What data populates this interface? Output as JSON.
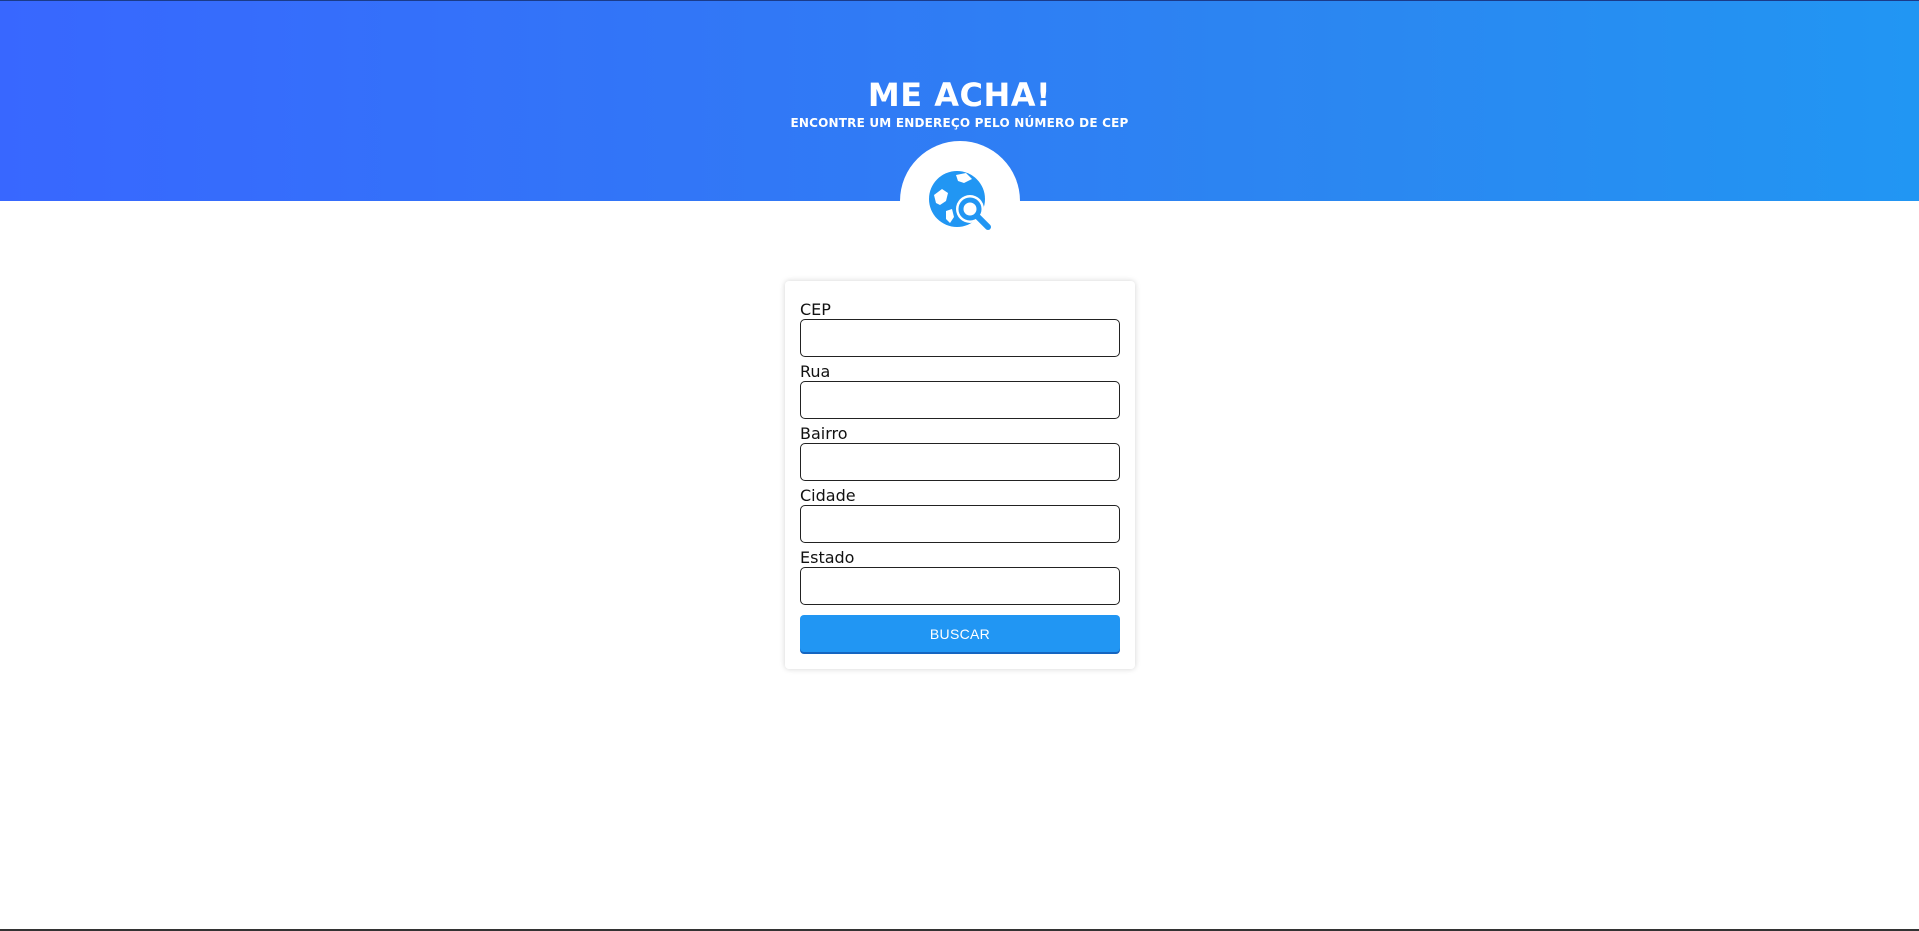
{
  "header": {
    "title": "ME ACHA!",
    "subtitle": "ENCONTRE UM ENDEREÇO PELO NÚMERO DE CEP",
    "logo_icon": "travel-explore-icon",
    "gradient_start": "#3867ff",
    "gradient_end": "#2196f3"
  },
  "form": {
    "fields": [
      {
        "label": "CEP",
        "value": ""
      },
      {
        "label": "Rua",
        "value": ""
      },
      {
        "label": "Bairro",
        "value": ""
      },
      {
        "label": "Cidade",
        "value": ""
      },
      {
        "label": "Estado",
        "value": ""
      }
    ],
    "submit_label": "BUSCAR",
    "accent_color": "#2196f3"
  }
}
